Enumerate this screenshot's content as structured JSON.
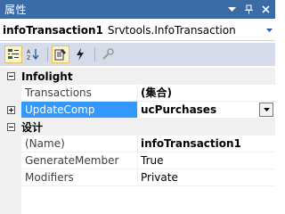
{
  "window": {
    "title": "属性"
  },
  "object_selector": {
    "name": "infoTransaction1",
    "type": "Srvtools.InfoTransaction"
  },
  "toolbar": {
    "buttons": [
      "categorized-icon",
      "alphabetical-icon",
      "properties-icon",
      "events-icon",
      "property-pages-icon"
    ]
  },
  "categories": [
    {
      "label": "Infolight",
      "properties": [
        {
          "name": "Transactions",
          "value": "(集合)",
          "bold": true
        },
        {
          "name": "UpdateComp",
          "value": "ucPurchases",
          "bold": true,
          "selected": true
        }
      ]
    },
    {
      "label": "设计",
      "properties": [
        {
          "name": "(Name)",
          "value": "infoTransaction1",
          "bold": true
        },
        {
          "name": "GenerateMember",
          "value": "True",
          "bold": false
        },
        {
          "name": "Modifiers",
          "value": "Private",
          "bold": false
        }
      ]
    }
  ],
  "colors": {
    "titlebar": "#3a6ba5",
    "selection": "#3399ff",
    "toolbar": "#d6dbe9"
  }
}
